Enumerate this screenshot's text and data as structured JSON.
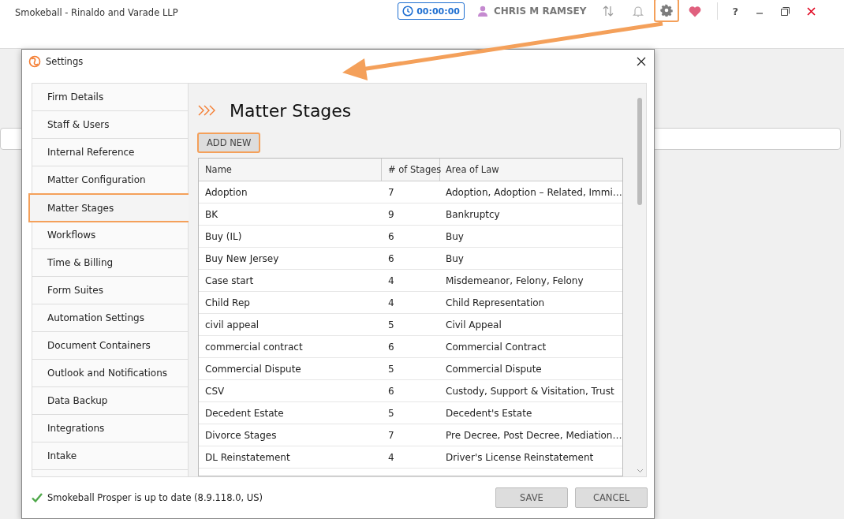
{
  "app": {
    "title": "Smokeball  - Rinaldo and Varade LLP",
    "timer": "00:00:00",
    "user": "CHRIS M RAMSEY",
    "help": "?"
  },
  "dialog": {
    "title": "Settings",
    "nav": [
      {
        "label": "Firm Details",
        "selected": false
      },
      {
        "label": "Staff & Users",
        "selected": false
      },
      {
        "label": "Internal Reference",
        "selected": false
      },
      {
        "label": "Matter Configuration",
        "selected": false
      },
      {
        "label": "Matter Stages",
        "selected": true
      },
      {
        "label": "Workflows",
        "selected": false
      },
      {
        "label": "Time & Billing",
        "selected": false
      },
      {
        "label": "Form Suites",
        "selected": false
      },
      {
        "label": "Automation Settings",
        "selected": false
      },
      {
        "label": "Document Containers",
        "selected": false
      },
      {
        "label": "Outlook and Notifications",
        "selected": false
      },
      {
        "label": "Data Backup",
        "selected": false
      },
      {
        "label": "Integrations",
        "selected": false
      },
      {
        "label": "Intake",
        "selected": false
      }
    ],
    "heading": "Matter Stages",
    "add_button": "ADD NEW",
    "table": {
      "columns": [
        "Name",
        "# of Stages",
        "Area of Law"
      ],
      "rows": [
        [
          "Adoption",
          "7",
          "Adoption, Adoption – Related, Immi…"
        ],
        [
          "BK",
          "9",
          "Bankruptcy"
        ],
        [
          "Buy (IL)",
          "6",
          "Buy"
        ],
        [
          "Buy New Jersey",
          "6",
          "Buy"
        ],
        [
          "Case start",
          "4",
          "Misdemeanor, Felony, Felony"
        ],
        [
          "Child Rep",
          "4",
          "Child Representation"
        ],
        [
          "civil appeal",
          "5",
          "Civil Appeal"
        ],
        [
          "commercial contract",
          "6",
          "Commercial Contract"
        ],
        [
          "Commercial Dispute",
          "5",
          "Commercial Dispute"
        ],
        [
          "CSV",
          "6",
          "Custody, Support & Visitation, Trust"
        ],
        [
          "Decedent Estate",
          "5",
          "Decedent's Estate"
        ],
        [
          "Divorce Stages",
          "7",
          "Pre Decree, Post Decree, Mediation…"
        ],
        [
          "DL Reinstatement",
          "4",
          "Driver's License Reinstatement"
        ]
      ]
    },
    "status": "Smokeball Prosper is up to date (8.9.118.0, US)",
    "buttons": [
      "SAVE",
      "CANCEL"
    ]
  }
}
